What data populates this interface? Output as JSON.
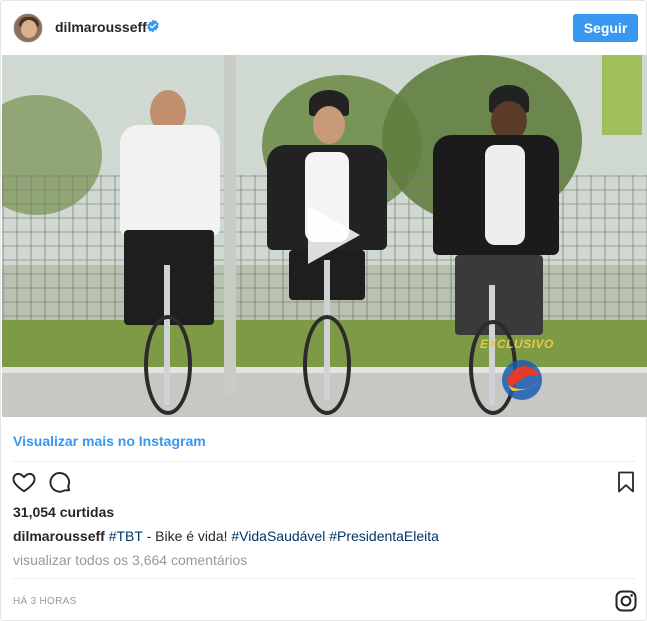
{
  "header": {
    "username": "dilmarousseff",
    "verified_icon": "verified-badge-icon",
    "follow_label": "Seguir",
    "accent_color": "#3897f0"
  },
  "media": {
    "type": "video",
    "play_icon": "play-icon",
    "watermark_text": "EXCLUSIVO"
  },
  "view_more_label": "Visualizar mais no Instagram",
  "actions": {
    "like_icon": "heart-icon",
    "comment_icon": "comment-icon",
    "save_icon": "bookmark-icon"
  },
  "likes_text": "31,054 curtidas",
  "caption": {
    "username": "dilmarousseff",
    "tag1": "#TBT",
    "middle_text": " - Bike é vida! ",
    "tag2": "#VidaSaudável",
    "tag3": "#PresidentaEleita"
  },
  "comments_link": "visualizar todos os 3,664 comentários",
  "timestamp": "HÁ 3 HORAS",
  "footer_icon": "instagram-icon"
}
